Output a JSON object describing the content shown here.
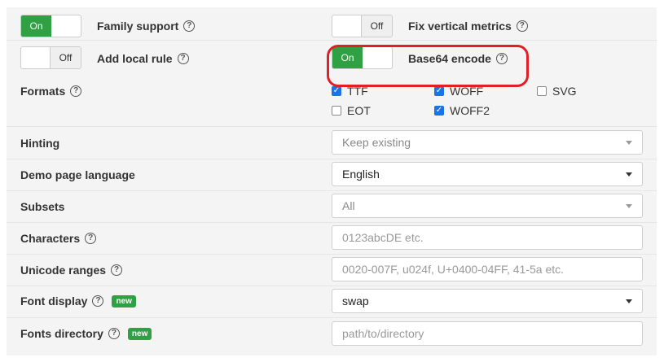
{
  "toggles": {
    "family_support": {
      "label": "Family support",
      "state": "On"
    },
    "add_local_rule": {
      "label": "Add local rule",
      "state": "Off"
    },
    "fix_vertical_metrics": {
      "label": "Fix vertical metrics",
      "state": "Off"
    },
    "base64_encode": {
      "label": "Base64 encode",
      "state": "On"
    }
  },
  "formats": {
    "label": "Formats",
    "options": [
      {
        "name": "TTF",
        "checked": true
      },
      {
        "name": "WOFF",
        "checked": true
      },
      {
        "name": "SVG",
        "checked": false
      },
      {
        "name": "EOT",
        "checked": false
      },
      {
        "name": "WOFF2",
        "checked": true
      }
    ]
  },
  "fields": {
    "hinting": {
      "label": "Hinting",
      "value": "Keep existing"
    },
    "demo_page_language": {
      "label": "Demo page language",
      "value": "English"
    },
    "subsets": {
      "label": "Subsets",
      "value": "All"
    },
    "characters": {
      "label": "Characters",
      "placeholder": "0123abcDE etc."
    },
    "unicode_ranges": {
      "label": "Unicode ranges",
      "placeholder": "0020-007F, u024f, U+0400-04FF, 41-5a etc."
    },
    "font_display": {
      "label": "Font display",
      "badge": "new",
      "value": "swap"
    },
    "fonts_directory": {
      "label": "Fonts directory",
      "badge": "new",
      "placeholder": "path/to/directory"
    }
  },
  "help_glyph": "?",
  "accent": "#2fa043",
  "highlight_color": "#e21f26"
}
